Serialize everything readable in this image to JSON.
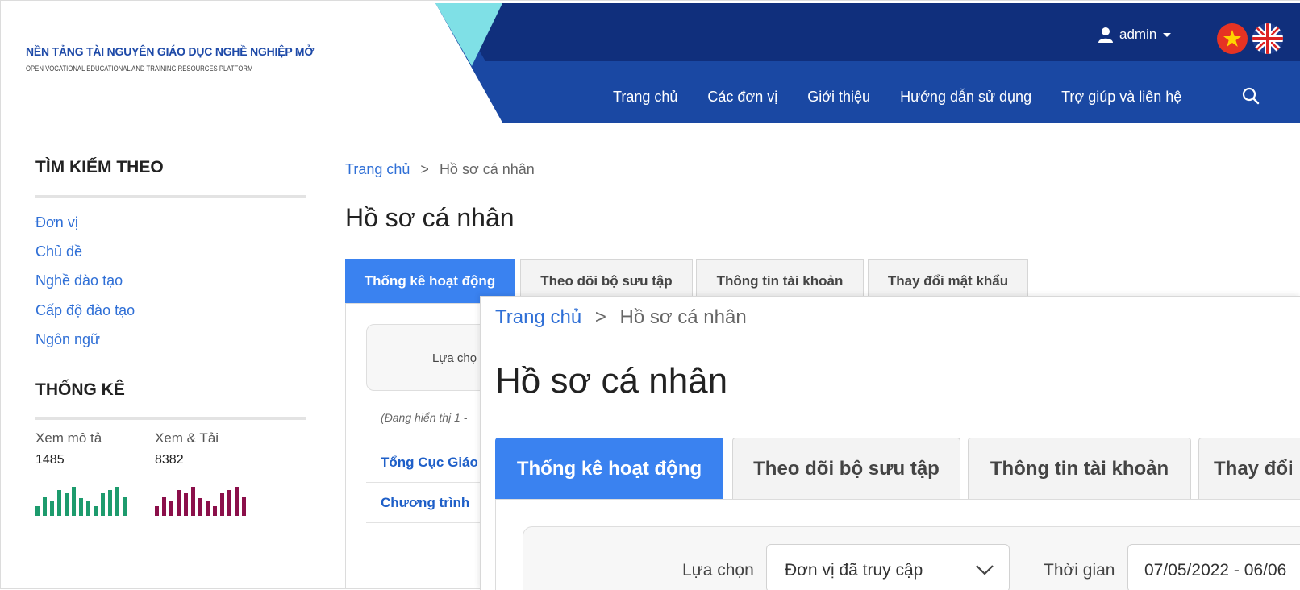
{
  "header": {
    "logo_title": "NỀN TẢNG TÀI NGUYÊN GIÁO DỤC NGHỀ NGHIỆP MỞ",
    "logo_subtitle": "OPEN VOCATIONAL EDUCATIONAL AND TRAINING RESOURCES PLATFORM",
    "user_label": "admin",
    "nav": [
      "Trang chủ",
      "Các đơn vị",
      "Giới thiệu",
      "Hướng dẫn sử dụng",
      "Trợ giúp và liên hệ"
    ],
    "colors": {
      "nav_bg": "#1a48a3",
      "top_band": "#0f2f7a",
      "accent_teal": "#7fe0e6"
    }
  },
  "sidebar": {
    "search_heading": "TÌM KIẾM THEO",
    "links": [
      "Đơn vị",
      "Chủ đề",
      "Nghề đào tạo",
      "Cấp độ đào tạo",
      "Ngôn ngữ"
    ],
    "stats_heading": "THỐNG KÊ",
    "stats": [
      {
        "label": "Xem mô tả",
        "value": "1485",
        "color": "#1d9b6d",
        "bars": [
          6,
          12,
          9,
          16,
          14,
          18,
          11,
          9,
          6,
          14,
          16,
          18,
          12
        ]
      },
      {
        "label": "Xem & Tải",
        "value": "8382",
        "color": "#8b0f4a",
        "bars": [
          6,
          12,
          9,
          16,
          14,
          18,
          11,
          9,
          6,
          14,
          16,
          18,
          12
        ]
      }
    ]
  },
  "main": {
    "breadcrumb_home": "Trang chủ",
    "breadcrumb_sep": ">",
    "breadcrumb_current": "Hồ sơ cá nhân",
    "title": "Hồ sơ cá nhân",
    "tabs": [
      "Thống kê hoạt động",
      "Theo dõi bộ sưu tập",
      "Thông tin tài khoản",
      "Thay đổi mật khẩu"
    ],
    "filter_label_partial": "Lựa chọ",
    "showing_partial": "(Đang hiển thị 1 -",
    "rows_partial": [
      "Tổng Cục Giáo",
      "Chương trình"
    ]
  },
  "zoom": {
    "breadcrumb_home": "Trang chủ",
    "breadcrumb_sep": ">",
    "breadcrumb_current": "Hồ sơ cá nhân",
    "title": "Hồ sơ cá nhân",
    "tabs": [
      "Thống kê hoạt động",
      "Theo dõi bộ sưu tập",
      "Thông tin tài khoản",
      "Thay đổi"
    ],
    "filter_label": "Lựa chọn",
    "filter_value": "Đơn vị đã truy cập",
    "time_label": "Thời gian",
    "time_value": "07/05/2022 - 06/06"
  }
}
